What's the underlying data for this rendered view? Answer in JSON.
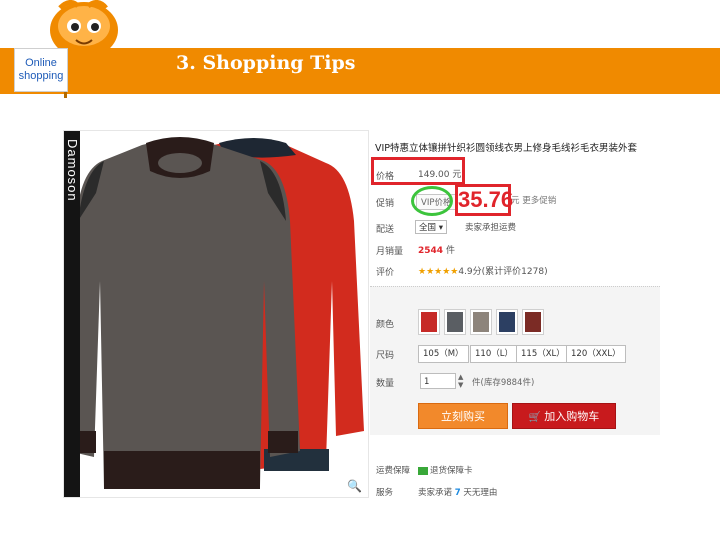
{
  "header": {
    "title": "3. Shopping Tips"
  },
  "logo": {
    "line1": "Online",
    "line2": "shopping",
    "color": "#f08a00"
  },
  "product_image": {
    "brand": "Damoson",
    "colors": [
      "#5a5552",
      "#d22b1e"
    ],
    "zoom_icon": "search-icon"
  },
  "product": {
    "title": "VIP特惠立体镶拼针织衫圆领线衣男上修身毛线衫毛衣男装外套",
    "price_label": "价格",
    "price": "149.00 元",
    "promo_label": "促销",
    "vip_label": "VIP价格",
    "vip_price": "35.76",
    "promo_note": "元 更多促销",
    "ship_label": "配送",
    "ship_select": "全国 ▾",
    "ship_note": "卖家承担运费",
    "sales_label": "月销量",
    "sales_count": "2544",
    "sales_unit": "件",
    "rating_label": "评价",
    "stars": "★★★★★",
    "rating_text": "4.9分(累计评价1278)",
    "color_label": "颜色",
    "color_swatches": [
      "#c62a27",
      "#5a5e63",
      "#8d847b",
      "#2c3f62",
      "#7b2b25"
    ],
    "size_label": "尺码",
    "sizes": [
      "105（M）",
      "110（L）",
      "115（XL）",
      "120（XXL）"
    ],
    "qty_label": "数量",
    "qty_value": "1",
    "stock_note": "件(库存9884件)",
    "buy_now": "立刻购买",
    "add_cart": "加入购物车",
    "service_label": "运费保障",
    "service_text": "退货保障卡",
    "service2_label": "服务",
    "service2_prefix": "卖家承诺",
    "service2_days": "7",
    "service2_suffix": "天无理由"
  }
}
